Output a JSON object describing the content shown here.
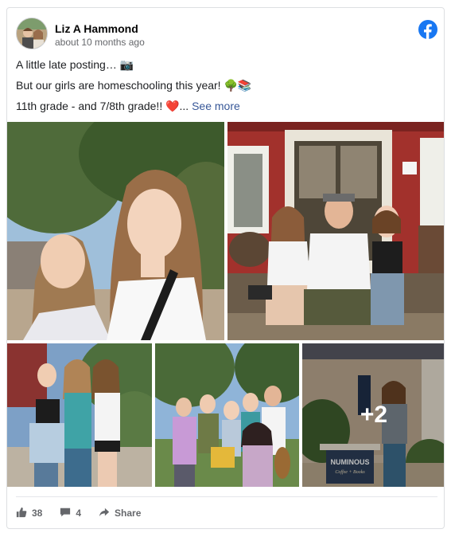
{
  "post": {
    "author": "Liz A Hammond",
    "timestamp": "about 10 months ago",
    "lines": [
      "A little late posting… 📷",
      "But our girls are homeschooling this year! 🌳📚",
      "11th grade - and 7/8th grade!! ❤️..."
    ],
    "see_more_label": "See more"
  },
  "photos": {
    "extra_count": "+2",
    "sign_text": "NUMINOUS",
    "sign_subtext": "Coffee + Books"
  },
  "footer": {
    "likes_count": "38",
    "comments_count": "4",
    "share_label": "Share"
  },
  "colors": {
    "brand": "#1877f2",
    "link": "#385898",
    "muted": "#65676b"
  },
  "icons": {
    "platform": "facebook-logo-icon",
    "like": "thumbs-up-icon",
    "comment": "comment-bubble-icon",
    "share": "share-arrow-icon"
  }
}
